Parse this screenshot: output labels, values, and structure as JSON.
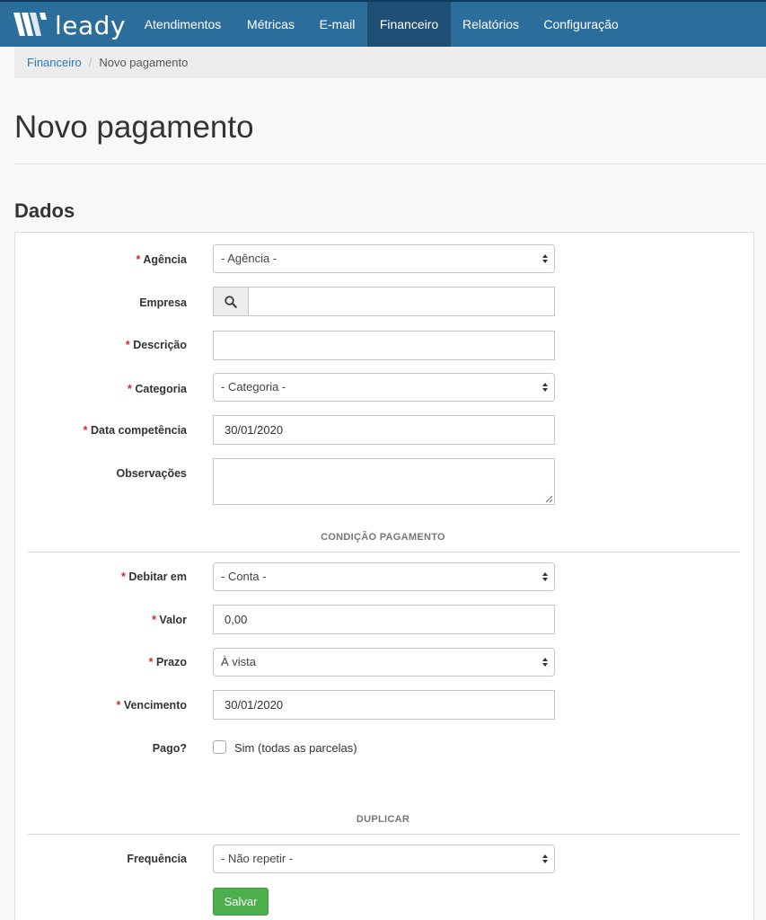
{
  "app": {
    "logo_text": "leady"
  },
  "nav": {
    "items": [
      {
        "label": "Atendimentos"
      },
      {
        "label": "Métricas"
      },
      {
        "label": "E-mail"
      },
      {
        "label": "Financeiro",
        "active": true
      },
      {
        "label": "Relatórios"
      },
      {
        "label": "Configuração"
      }
    ]
  },
  "breadcrumb": {
    "parent": "Financeiro",
    "separator": "/",
    "current": "Novo pagamento"
  },
  "page": {
    "title": "Novo pagamento",
    "section_title": "Dados"
  },
  "form": {
    "required_mark": "*",
    "agencia": {
      "label": "Agência",
      "value": "- Agência -"
    },
    "empresa": {
      "label": "Empresa",
      "value": ""
    },
    "descricao": {
      "label": "Descrição",
      "value": ""
    },
    "categoria": {
      "label": "Categoria",
      "value": "- Categoria -"
    },
    "data_competencia": {
      "label": "Data competência",
      "value": "30/01/2020"
    },
    "observacoes": {
      "label": "Observações",
      "value": ""
    },
    "condicao_title": "CONDIÇÃO PAGAMENTO",
    "debitar_em": {
      "label": "Debitar em",
      "value": "- Conta -"
    },
    "valor": {
      "label": "Valor",
      "value": "0,00"
    },
    "prazo": {
      "label": "Prazo",
      "value": "À vista"
    },
    "vencimento": {
      "label": "Vencimento",
      "value": "30/01/2020"
    },
    "pago": {
      "label": "Pago?",
      "option": "Sim (todas as parcelas)",
      "checked": false
    },
    "duplicar_title": "DUPLICAR",
    "frequencia": {
      "label": "Frequência",
      "value": "- Não repetir -"
    },
    "save_label": "Salvar"
  },
  "colors": {
    "navbar": "#2c6e9b",
    "navbar_active": "#1c4f73",
    "link": "#2a79bd",
    "required": "#d9232e",
    "save_button": "#4cae4c"
  },
  "icons": {
    "logo": "leady-logo-icon",
    "search": "search-icon",
    "select": "select-arrows-icon",
    "resize": "resize-handle-icon"
  }
}
